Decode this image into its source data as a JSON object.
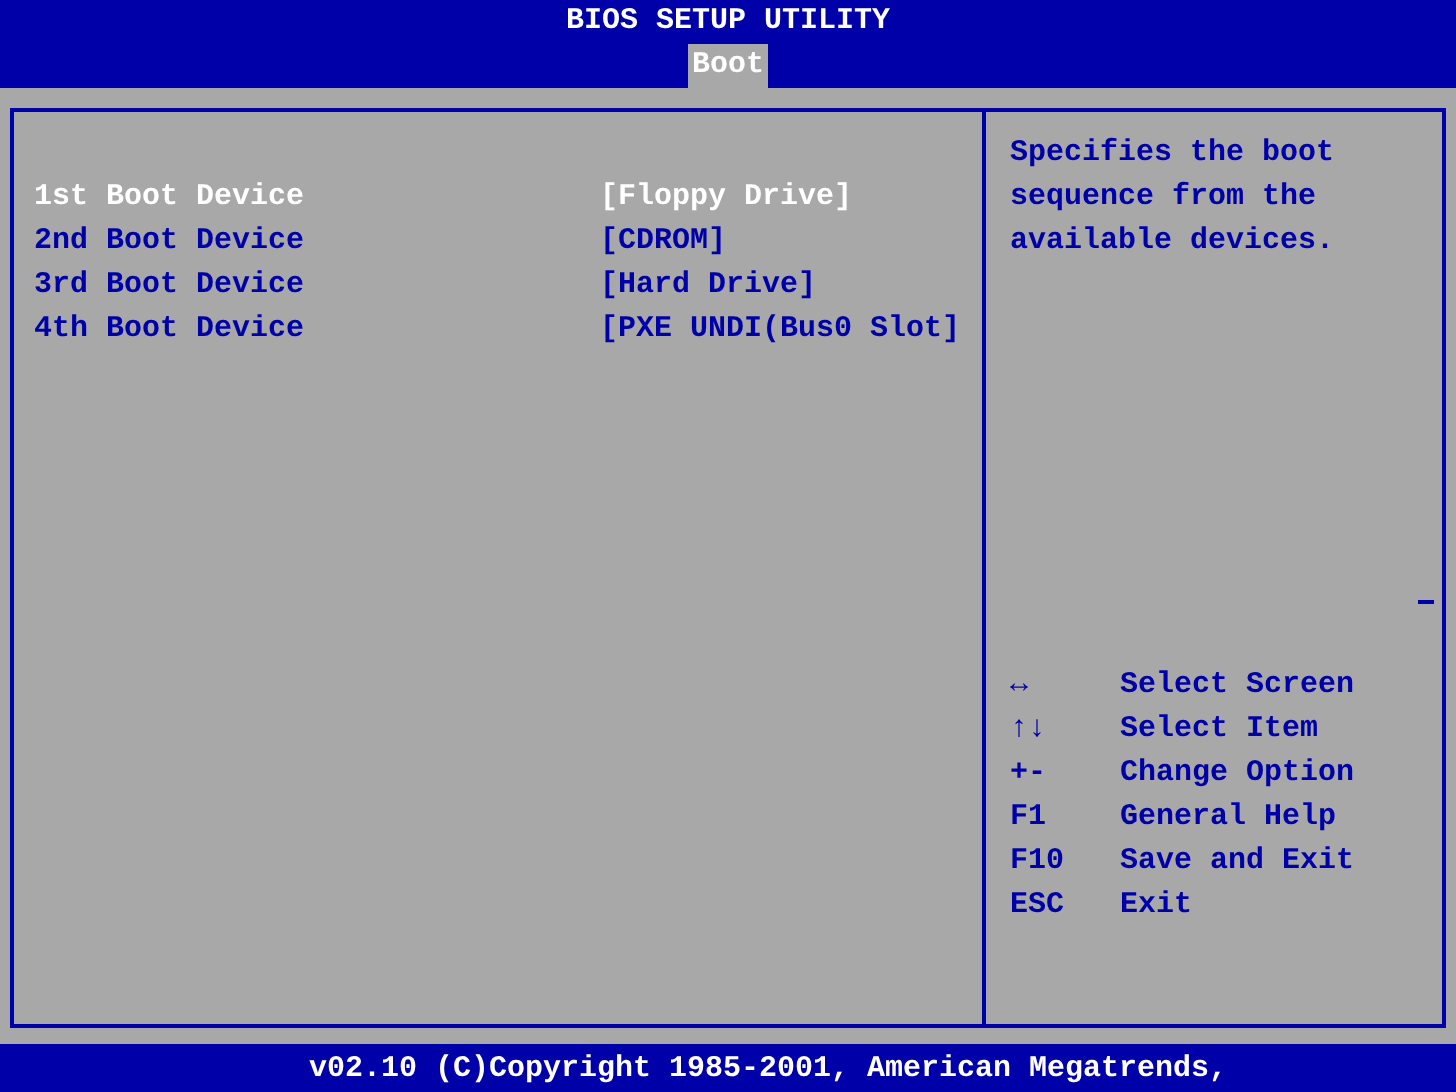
{
  "title": "BIOS SETUP UTILITY",
  "tabs": [
    {
      "label": "Boot",
      "selected": true
    }
  ],
  "boot_devices": [
    {
      "label": "1st Boot Device",
      "value": "[Floppy Drive]",
      "selected": true
    },
    {
      "label": "2nd Boot Device",
      "value": "[CDROM]",
      "selected": false
    },
    {
      "label": "3rd Boot Device",
      "value": "[Hard Drive]",
      "selected": false
    },
    {
      "label": "4th Boot Device",
      "value": "[PXE UNDI(Bus0 Slot]",
      "selected": false
    }
  ],
  "help_text": "Specifies the boot sequence from the available devices.",
  "key_legend": [
    {
      "key": "↔",
      "action": "Select Screen"
    },
    {
      "key": "↑↓",
      "action": "Select Item"
    },
    {
      "key": "+-",
      "action": "Change Option"
    },
    {
      "key": "F1",
      "action": "General Help"
    },
    {
      "key": "F10",
      "action": "Save and Exit"
    },
    {
      "key": "ESC",
      "action": "Exit"
    }
  ],
  "footer": "v02.10 (C)Copyright 1985-2001, American Megatrends,"
}
